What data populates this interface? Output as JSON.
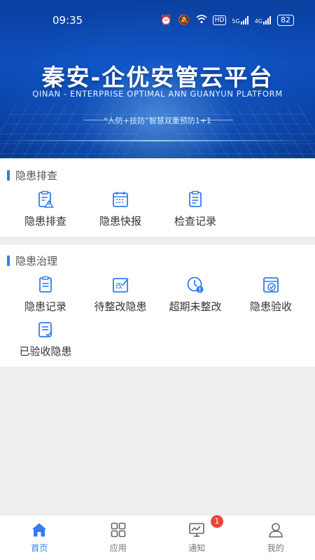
{
  "status_bar": {
    "time": "09:35",
    "battery": "82",
    "net1": "5G",
    "net2": "4G",
    "hd": "HD"
  },
  "banner": {
    "title": "秦安-企优安管云平台",
    "subtitle": "QINAN - ENTERPRISE OPTIMAL ANN GUANYUN PLATFORM",
    "slogan": "“人防+技防”智慧双重预防1+1"
  },
  "colors": {
    "accent": "#2f7ef0",
    "banner_blue": "#0d4fbf",
    "badge_red": "#e8453c"
  },
  "section_inspection": {
    "title": "隐患排查",
    "items": [
      {
        "label": "隐患排查",
        "icon": "clipboard-warning-icon"
      },
      {
        "label": "隐患快报",
        "icon": "calendar-report-icon"
      },
      {
        "label": "检查记录",
        "icon": "checklist-record-icon"
      }
    ]
  },
  "section_governance": {
    "title": "隐患治理",
    "items": [
      {
        "label": "隐患记录",
        "icon": "clipboard-record-icon"
      },
      {
        "label": "待整改隐患",
        "icon": "edit-box-icon"
      },
      {
        "label": "超期未整改",
        "icon": "clock-alert-icon"
      },
      {
        "label": "隐患验收",
        "icon": "acceptance-check-icon"
      },
      {
        "label": "已验收隐患",
        "icon": "document-check-icon"
      }
    ]
  },
  "tabbar": {
    "tabs": [
      {
        "label": "首页",
        "icon": "home-icon",
        "active": true
      },
      {
        "label": "应用",
        "icon": "apps-grid-icon",
        "active": false
      },
      {
        "label": "通知",
        "icon": "monitor-chart-icon",
        "active": false
      },
      {
        "label": "我的",
        "icon": "user-icon",
        "active": false
      }
    ],
    "notification_badge": "1"
  }
}
